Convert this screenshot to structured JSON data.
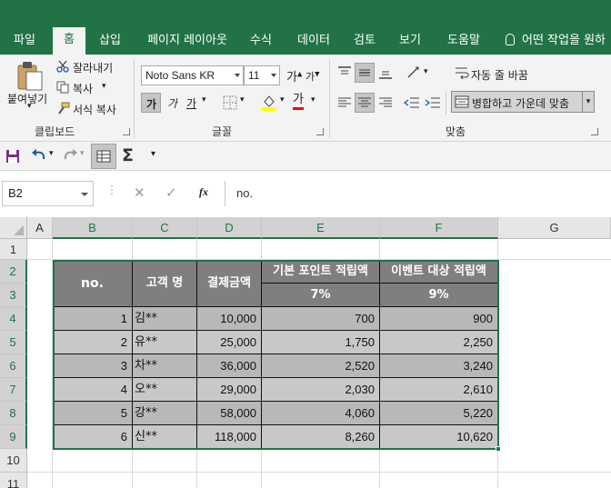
{
  "ribbon": {
    "tabs": [
      {
        "label": "파일",
        "active": false
      },
      {
        "label": "홈",
        "active": true
      },
      {
        "label": "삽입",
        "active": false
      },
      {
        "label": "페이지 레이아웃",
        "active": false
      },
      {
        "label": "수식",
        "active": false
      },
      {
        "label": "데이터",
        "active": false
      },
      {
        "label": "검토",
        "active": false
      },
      {
        "label": "보기",
        "active": false
      },
      {
        "label": "도움말",
        "active": false
      }
    ],
    "tell_me": "어떤 작업을 원하",
    "clipboard": {
      "paste": "붙여넣기",
      "cut": "잘라내기",
      "copy": "복사",
      "format_painter": "서식 복사",
      "group": "클립보드"
    },
    "font": {
      "name": "Noto Sans KR",
      "size": "11",
      "bold": "가",
      "italic": "가",
      "underline": "가",
      "grow": "가",
      "shrink": "가",
      "color_letter": "가",
      "group": "글꼴",
      "fill_color": "#ffff00",
      "font_color": "#ff0000"
    },
    "alignment": {
      "wrap_text": "자동 줄 바꿈",
      "merge_center": "병합하고 가운데 맞춤",
      "group": "맞춤"
    }
  },
  "formula_bar": {
    "name_box": "B2",
    "fx": "fx",
    "content": "no."
  },
  "sheet": {
    "columns": [
      "A",
      "B",
      "C",
      "D",
      "E",
      "F",
      "G"
    ],
    "rows": [
      "1",
      "2",
      "3",
      "4",
      "5",
      "6",
      "7",
      "8",
      "9",
      "10",
      "11"
    ],
    "table": {
      "headers": {
        "no": "no.",
        "name": "고객 명",
        "amount": "결제금액",
        "basic": "기본 포인트 적립액",
        "event": "이벤트 대상 적립액",
        "basic_rate": "7%",
        "event_rate": "9%"
      },
      "rows": [
        {
          "no": "1",
          "name": "김**",
          "amount": "10,000",
          "basic": "700",
          "event": "900"
        },
        {
          "no": "2",
          "name": "유**",
          "amount": "25,000",
          "basic": "1,750",
          "event": "2,250"
        },
        {
          "no": "3",
          "name": "차**",
          "amount": "36,000",
          "basic": "2,520",
          "event": "3,240"
        },
        {
          "no": "4",
          "name": "오**",
          "amount": "29,000",
          "basic": "2,030",
          "event": "2,610"
        },
        {
          "no": "5",
          "name": "강**",
          "amount": "58,000",
          "basic": "4,060",
          "event": "5,220"
        },
        {
          "no": "6",
          "name": "신**",
          "amount": "118,000",
          "basic": "8,260",
          "event": "10,620"
        }
      ]
    }
  },
  "colors": {
    "accent": "#217346",
    "header_fill": "#7f7f7f",
    "band_dark": "#b8b8b8",
    "band_light": "#c8c8c8"
  }
}
